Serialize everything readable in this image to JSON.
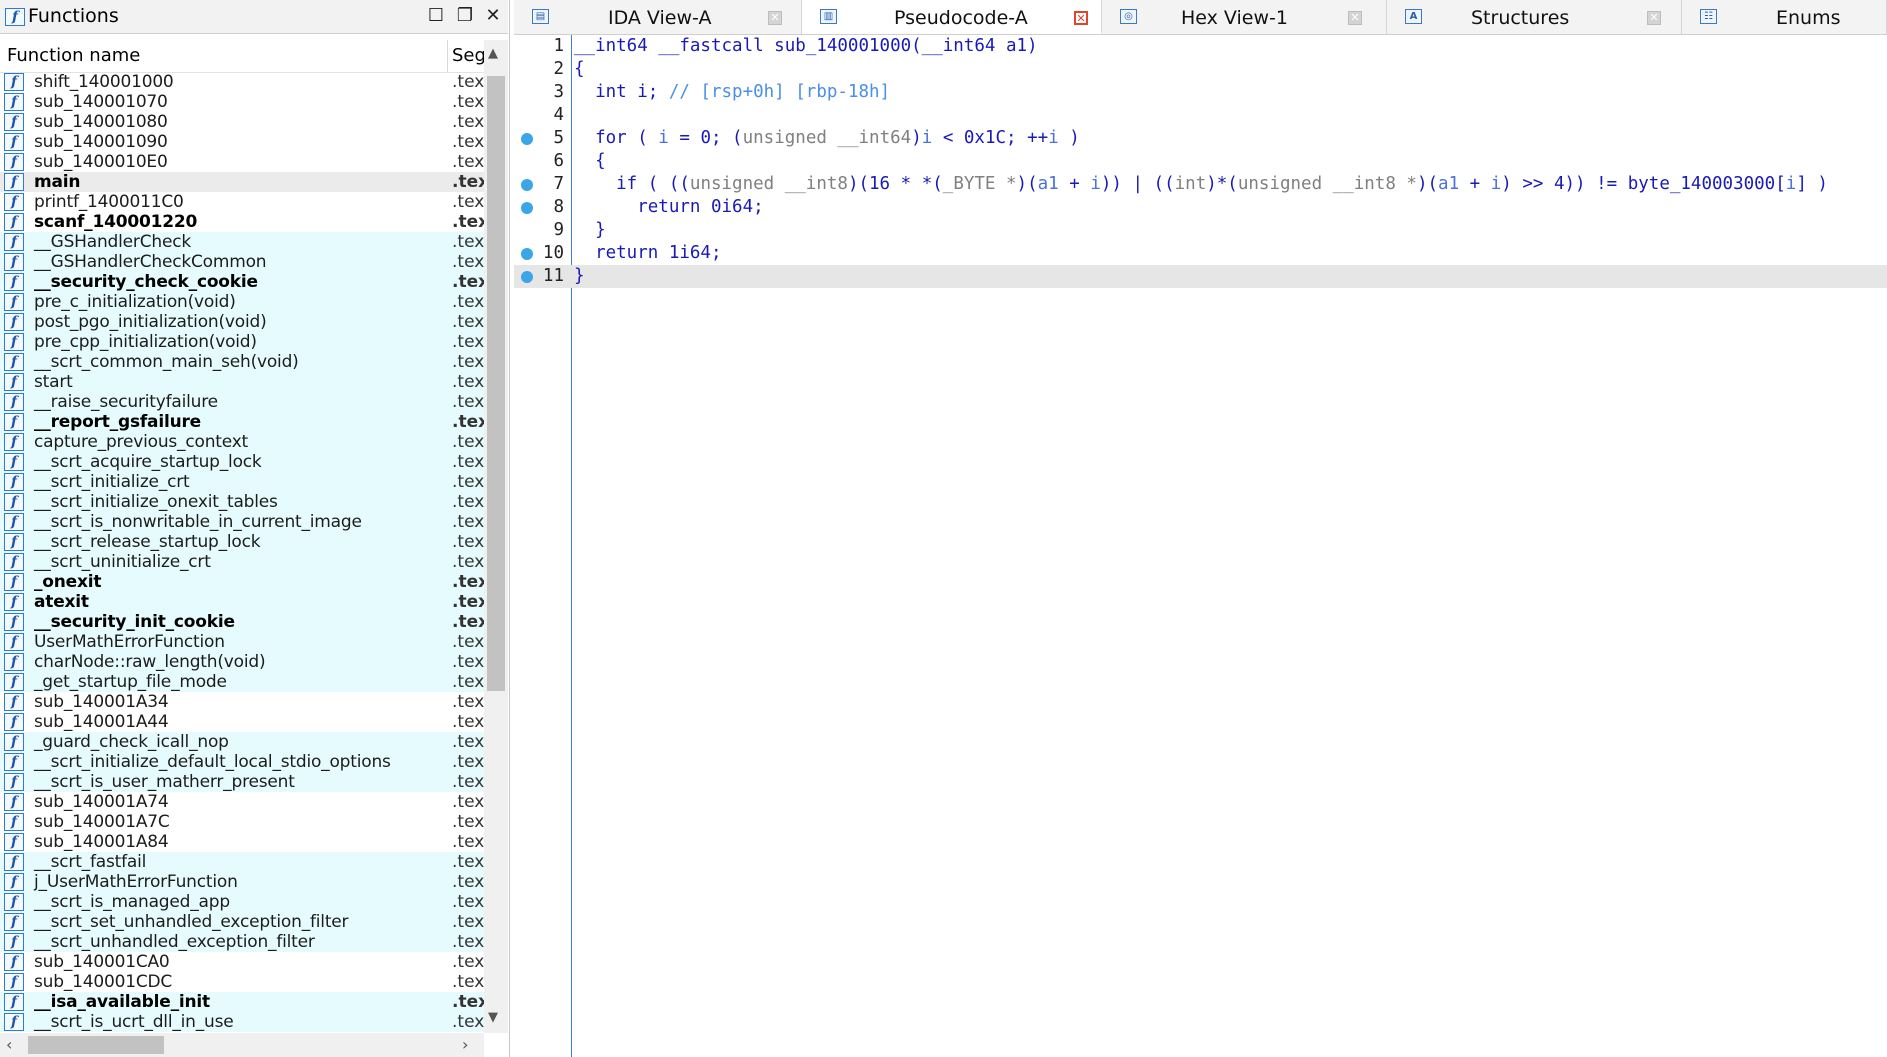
{
  "functions_pane": {
    "title": "Functions",
    "columns": {
      "name": "Function name",
      "segment": "Seg"
    },
    "rows": [
      {
        "name": "shift_140001000",
        "seg": ".tex",
        "bold": false,
        "lib": false,
        "selected": false
      },
      {
        "name": "sub_140001070",
        "seg": ".tex",
        "bold": false,
        "lib": false,
        "selected": false
      },
      {
        "name": "sub_140001080",
        "seg": ".tex",
        "bold": false,
        "lib": false,
        "selected": false
      },
      {
        "name": "sub_140001090",
        "seg": ".tex",
        "bold": false,
        "lib": false,
        "selected": false
      },
      {
        "name": "sub_1400010E0",
        "seg": ".tex",
        "bold": false,
        "lib": false,
        "selected": false
      },
      {
        "name": "main",
        "seg": ".tex",
        "bold": true,
        "lib": false,
        "selected": true
      },
      {
        "name": "printf_1400011C0",
        "seg": ".tex",
        "bold": false,
        "lib": false,
        "selected": false
      },
      {
        "name": "scanf_140001220",
        "seg": ".tex",
        "bold": true,
        "lib": false,
        "selected": false
      },
      {
        "name": "__GSHandlerCheck",
        "seg": ".tex",
        "bold": false,
        "lib": true,
        "selected": false
      },
      {
        "name": "__GSHandlerCheckCommon",
        "seg": ".tex",
        "bold": false,
        "lib": true,
        "selected": false
      },
      {
        "name": "__security_check_cookie",
        "seg": ".tex",
        "bold": true,
        "lib": true,
        "selected": false
      },
      {
        "name": "pre_c_initialization(void)",
        "seg": ".tex",
        "bold": false,
        "lib": true,
        "selected": false
      },
      {
        "name": "post_pgo_initialization(void)",
        "seg": ".tex",
        "bold": false,
        "lib": true,
        "selected": false
      },
      {
        "name": "pre_cpp_initialization(void)",
        "seg": ".tex",
        "bold": false,
        "lib": true,
        "selected": false
      },
      {
        "name": "__scrt_common_main_seh(void)",
        "seg": ".tex",
        "bold": false,
        "lib": true,
        "selected": false
      },
      {
        "name": "start",
        "seg": ".tex",
        "bold": false,
        "lib": true,
        "selected": false
      },
      {
        "name": "__raise_securityfailure",
        "seg": ".tex",
        "bold": false,
        "lib": true,
        "selected": false
      },
      {
        "name": "__report_gsfailure",
        "seg": ".tex",
        "bold": true,
        "lib": true,
        "selected": false
      },
      {
        "name": "capture_previous_context",
        "seg": ".tex",
        "bold": false,
        "lib": true,
        "selected": false
      },
      {
        "name": "__scrt_acquire_startup_lock",
        "seg": ".tex",
        "bold": false,
        "lib": true,
        "selected": false
      },
      {
        "name": "__scrt_initialize_crt",
        "seg": ".tex",
        "bold": false,
        "lib": true,
        "selected": false
      },
      {
        "name": "__scrt_initialize_onexit_tables",
        "seg": ".tex",
        "bold": false,
        "lib": true,
        "selected": false
      },
      {
        "name": "__scrt_is_nonwritable_in_current_image",
        "seg": ".tex",
        "bold": false,
        "lib": true,
        "selected": false
      },
      {
        "name": "__scrt_release_startup_lock",
        "seg": ".tex",
        "bold": false,
        "lib": true,
        "selected": false
      },
      {
        "name": "__scrt_uninitialize_crt",
        "seg": ".tex",
        "bold": false,
        "lib": true,
        "selected": false
      },
      {
        "name": "_onexit",
        "seg": ".tex",
        "bold": true,
        "lib": true,
        "selected": false
      },
      {
        "name": "atexit",
        "seg": ".tex",
        "bold": true,
        "lib": true,
        "selected": false
      },
      {
        "name": "__security_init_cookie",
        "seg": ".tex",
        "bold": true,
        "lib": true,
        "selected": false
      },
      {
        "name": "UserMathErrorFunction",
        "seg": ".tex",
        "bold": false,
        "lib": true,
        "selected": false
      },
      {
        "name": "charNode::raw_length(void)",
        "seg": ".tex",
        "bold": false,
        "lib": true,
        "selected": false
      },
      {
        "name": "_get_startup_file_mode",
        "seg": ".tex",
        "bold": false,
        "lib": true,
        "selected": false
      },
      {
        "name": "sub_140001A34",
        "seg": ".tex",
        "bold": false,
        "lib": false,
        "selected": false
      },
      {
        "name": "sub_140001A44",
        "seg": ".tex",
        "bold": false,
        "lib": false,
        "selected": false
      },
      {
        "name": "_guard_check_icall_nop",
        "seg": ".tex",
        "bold": false,
        "lib": true,
        "selected": false
      },
      {
        "name": "__scrt_initialize_default_local_stdio_options",
        "seg": ".tex",
        "bold": false,
        "lib": true,
        "selected": false
      },
      {
        "name": "__scrt_is_user_matherr_present",
        "seg": ".tex",
        "bold": false,
        "lib": true,
        "selected": false
      },
      {
        "name": "sub_140001A74",
        "seg": ".tex",
        "bold": false,
        "lib": false,
        "selected": false
      },
      {
        "name": "sub_140001A7C",
        "seg": ".tex",
        "bold": false,
        "lib": false,
        "selected": false
      },
      {
        "name": "sub_140001A84",
        "seg": ".tex",
        "bold": false,
        "lib": false,
        "selected": false
      },
      {
        "name": "__scrt_fastfail",
        "seg": ".tex",
        "bold": false,
        "lib": true,
        "selected": false
      },
      {
        "name": "j_UserMathErrorFunction",
        "seg": ".tex",
        "bold": false,
        "lib": true,
        "selected": false
      },
      {
        "name": "__scrt_is_managed_app",
        "seg": ".tex",
        "bold": false,
        "lib": true,
        "selected": false
      },
      {
        "name": "__scrt_set_unhandled_exception_filter",
        "seg": ".tex",
        "bold": false,
        "lib": true,
        "selected": false
      },
      {
        "name": "__scrt_unhandled_exception_filter",
        "seg": ".tex",
        "bold": false,
        "lib": true,
        "selected": false
      },
      {
        "name": "sub_140001CA0",
        "seg": ".tex",
        "bold": false,
        "lib": false,
        "selected": false
      },
      {
        "name": "sub_140001CDC",
        "seg": ".tex",
        "bold": false,
        "lib": false,
        "selected": false
      },
      {
        "name": "__isa_available_init",
        "seg": ".tex",
        "bold": true,
        "lib": true,
        "selected": false
      },
      {
        "name": "__scrt_is_ucrt_dll_in_use",
        "seg": ".tex",
        "bold": false,
        "lib": true,
        "selected": false
      }
    ]
  },
  "tabs": [
    {
      "label": "IDA View-A",
      "icon": "ida-view-icon",
      "active": false,
      "close": "grey"
    },
    {
      "label": "Pseudocode-A",
      "icon": "pseudocode-icon",
      "active": true,
      "close": "red"
    },
    {
      "label": "Hex View-1",
      "icon": "hex-view-icon",
      "active": false,
      "close": "grey"
    },
    {
      "label": "Structures",
      "icon": "structures-icon",
      "active": false,
      "close": "grey"
    },
    {
      "label": "Enums",
      "icon": "enums-icon",
      "active": false,
      "close": "none"
    }
  ],
  "code": {
    "current_line": 11,
    "lines": [
      {
        "no": "1",
        "bp": false,
        "parts": [
          [
            "kw",
            "__int64 __fastcall sub_140001000(__int64 a1)"
          ]
        ]
      },
      {
        "no": "2",
        "bp": false,
        "parts": [
          [
            "kw",
            "{"
          ]
        ]
      },
      {
        "no": "3",
        "bp": false,
        "parts": [
          [
            "kw",
            "  int i; "
          ],
          [
            "cm",
            "// [rsp+0h] [rbp-18h]"
          ]
        ]
      },
      {
        "no": "4",
        "bp": false,
        "parts": []
      },
      {
        "no": "5",
        "bp": true,
        "parts": [
          [
            "kw",
            "  for ( "
          ],
          [
            "vr",
            "i"
          ],
          [
            "kw",
            " = 0; ("
          ],
          [
            "gr",
            "unsigned __int64"
          ],
          [
            "kw",
            ")"
          ],
          [
            "vr",
            "i"
          ],
          [
            "kw",
            " < 0x1C; ++"
          ],
          [
            "vr",
            "i"
          ],
          [
            "kw",
            " )"
          ]
        ]
      },
      {
        "no": "6",
        "bp": false,
        "parts": [
          [
            "kw",
            "  {"
          ]
        ]
      },
      {
        "no": "7",
        "bp": true,
        "parts": [
          [
            "kw",
            "    if ( (("
          ],
          [
            "gr",
            "unsigned __int8"
          ],
          [
            "kw",
            ")(16 * *("
          ],
          [
            "gr",
            "_BYTE *"
          ],
          [
            "kw",
            ")("
          ],
          [
            "vr",
            "a1"
          ],
          [
            "kw",
            " + "
          ],
          [
            "vr",
            "i"
          ],
          [
            "kw",
            ")) | (("
          ],
          [
            "gr",
            "int"
          ],
          [
            "kw",
            ")*("
          ],
          [
            "gr",
            "unsigned __int8 *"
          ],
          [
            "kw",
            ")("
          ],
          [
            "vr",
            "a1"
          ],
          [
            "kw",
            " + "
          ],
          [
            "vr",
            "i"
          ],
          [
            "kw",
            ") >> 4)) != byte_140003000["
          ],
          [
            "vr",
            "i"
          ],
          [
            "kw",
            "] )"
          ]
        ]
      },
      {
        "no": "8",
        "bp": true,
        "parts": [
          [
            "kw",
            "      return 0i64;"
          ]
        ]
      },
      {
        "no": "9",
        "bp": false,
        "parts": [
          [
            "kw",
            "  }"
          ]
        ]
      },
      {
        "no": "10",
        "bp": true,
        "parts": [
          [
            "kw",
            "  return 1i64;"
          ]
        ]
      },
      {
        "no": "11",
        "bp": true,
        "parts": [
          [
            "kw",
            "}"
          ]
        ]
      }
    ]
  },
  "colors": {
    "library_row": "#e6fbfd",
    "selected_row": "#ebebeb",
    "keyword": "#1a1ab8",
    "type_grey": "#808080",
    "variable": "#4b70e0",
    "comment": "#4a8fe8",
    "breakpoint": "#3aa6e8"
  }
}
